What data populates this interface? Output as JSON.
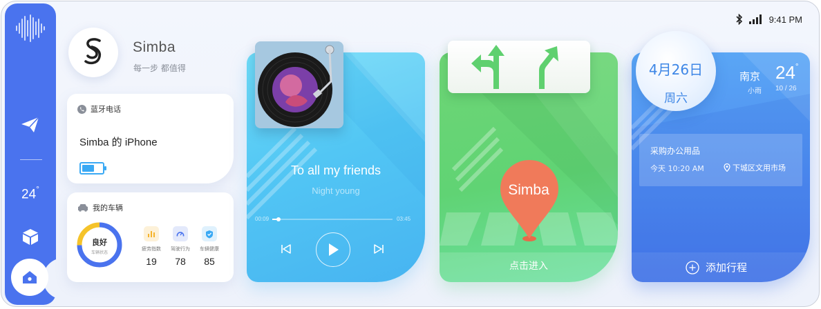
{
  "status": {
    "time": "9:41 PM",
    "bluetooth_icon": "bluetooth-icon",
    "signal_icon": "signal-icon"
  },
  "sidebar": {
    "temperature": "24",
    "degree": "°",
    "items": [
      "voice-wave-icon",
      "send-icon",
      "box-icon",
      "home-icon"
    ]
  },
  "profile": {
    "name": "Simba",
    "slogan": "每一步 都值得"
  },
  "bluetooth_card": {
    "title": "蓝牙电话",
    "device": "Simba 的 iPhone",
    "battery_level": 0.6
  },
  "car_card": {
    "title": "我的车辆",
    "status": "良好",
    "status_label": "车辆状态",
    "metrics": [
      {
        "label": "疲劳指数",
        "value": "19",
        "icon": "bar-chart-icon",
        "color": "#f5b32a"
      },
      {
        "label": "驾驶行为",
        "value": "78",
        "icon": "speedometer-icon",
        "color": "#4a73ee"
      },
      {
        "label": "车辆健康",
        "value": "85",
        "icon": "shield-check-icon",
        "color": "#3aa9f4"
      }
    ]
  },
  "music": {
    "title": "To all my friends",
    "artist": "Night young",
    "current_time": "00:09",
    "total_time": "03:45",
    "progress": 0.05
  },
  "nav": {
    "pin_label": "Simba",
    "enter_label": "点击进入"
  },
  "calendar": {
    "date": "4月26日",
    "weekday": "周六",
    "city": "南京",
    "weather": "小雨",
    "temp": "24",
    "degree": "°",
    "temp_range": "10 / 26",
    "event_title": "采购办公用品",
    "event_time": "今天 10:20 AM",
    "event_location": "下城区文用市场",
    "add_label": "添加行程"
  },
  "colors": {
    "sidebar": "#4a73ee",
    "music": "#52c6f4",
    "nav": "#60d374",
    "calendar": "#4d8af0",
    "pin": "#f07a5a"
  }
}
